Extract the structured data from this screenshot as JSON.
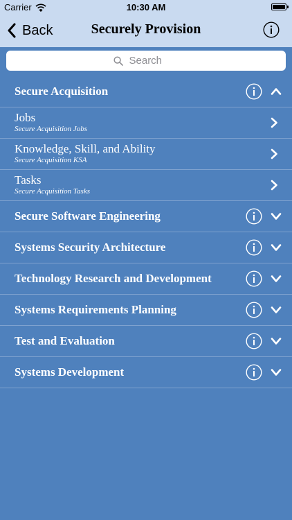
{
  "status_bar": {
    "carrier": "Carrier",
    "time": "10:30 AM"
  },
  "nav": {
    "back_label": "Back",
    "title": "Securely Provision"
  },
  "search": {
    "placeholder": "Search"
  },
  "sections": [
    {
      "label": "Secure Acquisition",
      "expanded": true,
      "items": [
        {
          "title": "Jobs",
          "subtitle": "Secure Acquisition Jobs"
        },
        {
          "title": "Knowledge, Skill, and Ability",
          "subtitle": "Secure Acquisition KSA"
        },
        {
          "title": "Tasks",
          "subtitle": "Secure Acquisition Tasks"
        }
      ]
    },
    {
      "label": "Secure Software Engineering",
      "expanded": false
    },
    {
      "label": "Systems Security Architecture",
      "expanded": false
    },
    {
      "label": "Technology Research and Development",
      "expanded": false
    },
    {
      "label": "Systems Requirements Planning",
      "expanded": false
    },
    {
      "label": "Test and Evaluation",
      "expanded": false
    },
    {
      "label": "Systems Development",
      "expanded": false
    }
  ],
  "icons": {
    "back": "chevron-left-icon",
    "info": "info-icon",
    "search": "search-icon",
    "expand": "chevron-down-icon",
    "collapse": "chevron-up-icon",
    "disclosure": "chevron-right-icon"
  },
  "colors": {
    "background": "#4f81bd",
    "nav_background": "#c9daf0",
    "separator": "#7fa2cf",
    "text": "#ffffff"
  }
}
